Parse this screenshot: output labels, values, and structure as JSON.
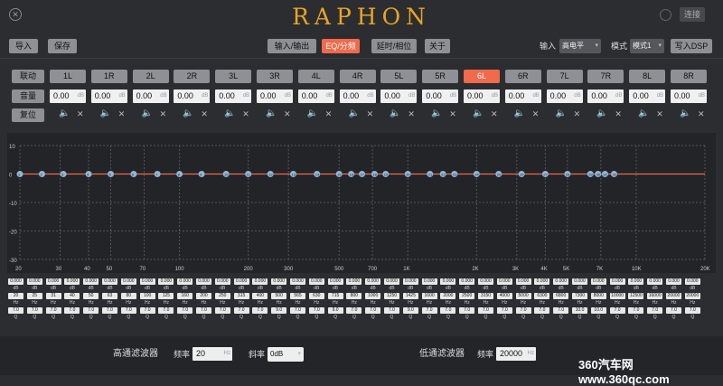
{
  "app": {
    "logo_text": "RAPHON",
    "connect_label": "连接"
  },
  "toolbar": {
    "import": "导入",
    "save": "保存",
    "tabs": [
      "输入/输出",
      "EQ/分频",
      "延时/相位",
      "关于"
    ],
    "active_tab": 1,
    "input_label": "输入",
    "input_value": "高电平",
    "mode_label": "模式",
    "mode_value": "模式1",
    "write_label": "写入DSP"
  },
  "channels": {
    "link_label": "联动",
    "volume_label": "音量",
    "reset_label": "复位",
    "names": [
      "1L",
      "1R",
      "2L",
      "2R",
      "3L",
      "3R",
      "4L",
      "4R",
      "5L",
      "5R",
      "6L",
      "6R",
      "7L",
      "7R",
      "8L",
      "8R"
    ],
    "active": 10,
    "volumes": [
      "0.00",
      "0.00",
      "0.00",
      "0.00",
      "0.00",
      "0.00",
      "0.00",
      "0.00",
      "0.00",
      "0.00",
      "0.00",
      "0.00",
      "0.00",
      "0.00",
      "0.00",
      "0.00"
    ],
    "db_unit": "dB"
  },
  "graph": {
    "y_ticks": [
      "10",
      "0",
      "-10",
      "-20",
      "-30"
    ],
    "x_ticks": [
      "20",
      "30",
      "40",
      "50",
      "70",
      "100",
      "200",
      "300",
      "500",
      "700",
      "1K",
      "2K",
      "3K",
      "4K",
      "5K",
      "7K",
      "10K",
      "20K"
    ],
    "points": [
      "1",
      "2",
      "3",
      "4",
      "5",
      "6",
      "7",
      "8",
      "9",
      "10",
      "11",
      "12",
      "13",
      "14",
      "15",
      "16",
      "17",
      "18",
      "19",
      "20",
      "21",
      "22",
      "23",
      "24",
      "25",
      "26",
      "27",
      "28",
      "29",
      "30",
      "31",
      "32"
    ],
    "line_color": "#f06a4b",
    "point_color": "#8fb8d8"
  },
  "bands": {
    "gains": [
      "0.000",
      "0.000",
      "0.000",
      "0.000",
      "0.000",
      "0.000",
      "0.000",
      "0.000",
      "0.000",
      "0.000",
      "0.000",
      "0.000",
      "0.000",
      "0.000",
      "0.000",
      "0.000",
      "0.000",
      "0.000",
      "0.000",
      "0.000",
      "0.000",
      "0.000",
      "0.000",
      "0.000",
      "0.000",
      "0.000",
      "0.000",
      "0.000",
      "0.000",
      "0.000",
      "0.000",
      "0.000",
      "0.000",
      "0.000",
      "0.000",
      "0.000",
      "0.000"
    ],
    "gain_unit": "dB",
    "freqs": [
      "20",
      "25",
      "31",
      "40",
      "50",
      "63",
      "80",
      "100",
      "125",
      "160",
      "200",
      "250",
      "315",
      "400",
      "500",
      "565",
      "630",
      "715",
      "800",
      "1000",
      "1250",
      "1425",
      "1600",
      "2000",
      "2500",
      "3150",
      "4000",
      "5000",
      "6300",
      "6800",
      "7300",
      "8000",
      "10000",
      "12500",
      "16000",
      "20000",
      "20000"
    ],
    "freq_unit": "Hz",
    "qs": [
      "7.0",
      "7.0",
      "7.0",
      "7.0",
      "7.0",
      "7.0",
      "7.0",
      "7.0",
      "7.0",
      "7.0",
      "7.0",
      "7.0",
      "7.0",
      "7.0",
      "9.0",
      "7.0",
      "7.0",
      "9.0",
      "7.0",
      "7.0",
      "7.0",
      "9.0",
      "7.0",
      "7.0",
      "7.0",
      "7.0",
      "7.0",
      "7.0",
      "7.0",
      "7.0",
      "10.0",
      "10.0",
      "7.0",
      "7.0",
      "7.0",
      "7.0",
      "7.0"
    ],
    "q_unit": "Q"
  },
  "filters": {
    "hp_title": "高通滤波器",
    "hp_freq_label": "频率",
    "hp_freq": "20",
    "hz": "Hz",
    "slope_label": "斜率",
    "hp_slope": "0dB",
    "lp_title": "低通滤波器",
    "lp_freq_label": "频率",
    "lp_freq": "20000"
  },
  "watermark": "360汽车网 www.360qc.com"
}
